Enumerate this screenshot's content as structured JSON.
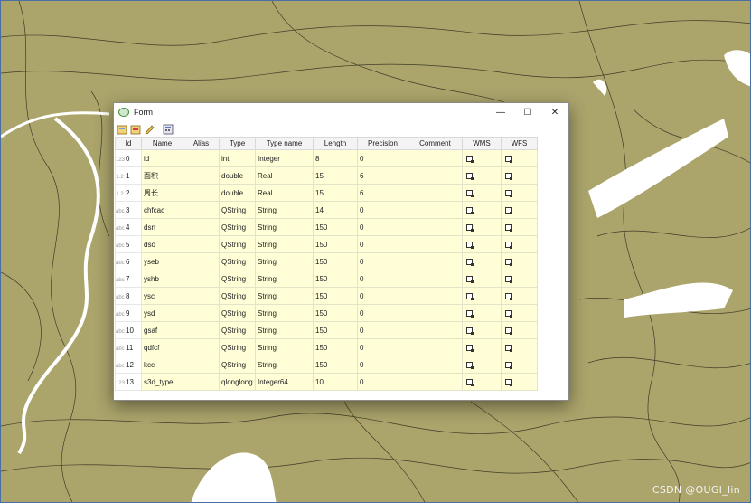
{
  "window": {
    "title": "Form",
    "minimize": "—",
    "maximize": "☐",
    "close": "✕"
  },
  "toolbar": {
    "icons": [
      "open-layer-icon",
      "delete-field-icon",
      "edit-pencil-icon",
      "calculator-icon"
    ]
  },
  "table": {
    "headers": [
      "Id",
      "Name",
      "Alias",
      "Type",
      "Type name",
      "Length",
      "Precision",
      "Comment",
      "WMS",
      "WFS"
    ],
    "rows": [
      {
        "rh": "123",
        "id": "0",
        "name": "id",
        "alias": "",
        "type": "int",
        "type_name": "Integer",
        "length": "8",
        "precision": "0",
        "comment": ""
      },
      {
        "rh": "1.2",
        "id": "1",
        "name": "面积",
        "alias": "",
        "type": "double",
        "type_name": "Real",
        "length": "15",
        "precision": "6",
        "comment": ""
      },
      {
        "rh": "1.2",
        "id": "2",
        "name": "周长",
        "alias": "",
        "type": "double",
        "type_name": "Real",
        "length": "15",
        "precision": "6",
        "comment": ""
      },
      {
        "rh": "abc",
        "id": "3",
        "name": "chfcac",
        "alias": "",
        "type": "QString",
        "type_name": "String",
        "length": "14",
        "precision": "0",
        "comment": ""
      },
      {
        "rh": "abc",
        "id": "4",
        "name": "dsn",
        "alias": "",
        "type": "QString",
        "type_name": "String",
        "length": "150",
        "precision": "0",
        "comment": ""
      },
      {
        "rh": "abc",
        "id": "5",
        "name": "dso",
        "alias": "",
        "type": "QString",
        "type_name": "String",
        "length": "150",
        "precision": "0",
        "comment": ""
      },
      {
        "rh": "abc",
        "id": "6",
        "name": "yseb",
        "alias": "",
        "type": "QString",
        "type_name": "String",
        "length": "150",
        "precision": "0",
        "comment": ""
      },
      {
        "rh": "abc",
        "id": "7",
        "name": "yshb",
        "alias": "",
        "type": "QString",
        "type_name": "String",
        "length": "150",
        "precision": "0",
        "comment": ""
      },
      {
        "rh": "abc",
        "id": "8",
        "name": "ysc",
        "alias": "",
        "type": "QString",
        "type_name": "String",
        "length": "150",
        "precision": "0",
        "comment": ""
      },
      {
        "rh": "abc",
        "id": "9",
        "name": "ysd",
        "alias": "",
        "type": "QString",
        "type_name": "String",
        "length": "150",
        "precision": "0",
        "comment": ""
      },
      {
        "rh": "abc",
        "id": "10",
        "name": "gsaf",
        "alias": "",
        "type": "QString",
        "type_name": "String",
        "length": "150",
        "precision": "0",
        "comment": ""
      },
      {
        "rh": "abc",
        "id": "11",
        "name": "qdfcf",
        "alias": "",
        "type": "QString",
        "type_name": "String",
        "length": "150",
        "precision": "0",
        "comment": ""
      },
      {
        "rh": "abc",
        "id": "12",
        "name": "kcc",
        "alias": "",
        "type": "QString",
        "type_name": "String",
        "length": "150",
        "precision": "0",
        "comment": ""
      },
      {
        "rh": "123",
        "id": "13",
        "name": "s3d_type",
        "alias": "",
        "type": "qlonglong",
        "type_name": "Integer64",
        "length": "10",
        "precision": "0",
        "comment": ""
      }
    ]
  },
  "watermark": "CSDN @OUGI_lin",
  "colors": {
    "map_fill": "#aba46b",
    "cell_bg": "#fffed7",
    "header_bg": "#f4f4f4"
  }
}
